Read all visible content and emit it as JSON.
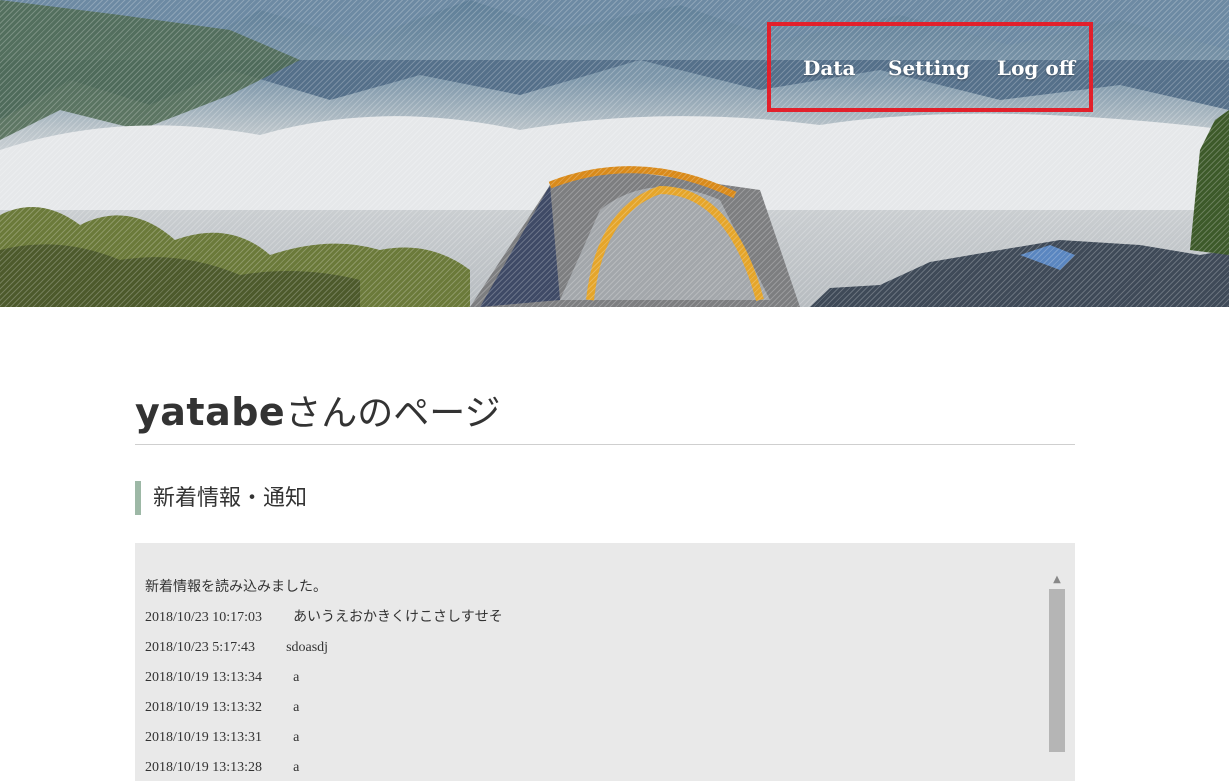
{
  "nav": {
    "items": [
      {
        "label": "Data"
      },
      {
        "label": "Setting"
      },
      {
        "label": "Log off"
      }
    ]
  },
  "page": {
    "user_name": "yatabe",
    "title_suffix": "さんのページ"
  },
  "news": {
    "heading": "新着情報・通知",
    "intro": "新着情報を読み込みました。",
    "items": [
      {
        "timestamp": "2018/10/23 10:17:03",
        "message": "あいうえおかきくけこさしすせそ"
      },
      {
        "timestamp": "2018/10/23 5:17:43",
        "message": "sdoasdj"
      },
      {
        "timestamp": "2018/10/19 13:13:34",
        "message": "a"
      },
      {
        "timestamp": "2018/10/19 13:13:32",
        "message": "a"
      },
      {
        "timestamp": "2018/10/19 13:13:31",
        "message": "a"
      },
      {
        "timestamp": "2018/10/19 13:13:28",
        "message": "a"
      }
    ]
  },
  "colors": {
    "nav_highlight": "#e2202b",
    "heading_accent": "#9db8a6",
    "news_background": "#e9e9e9"
  }
}
